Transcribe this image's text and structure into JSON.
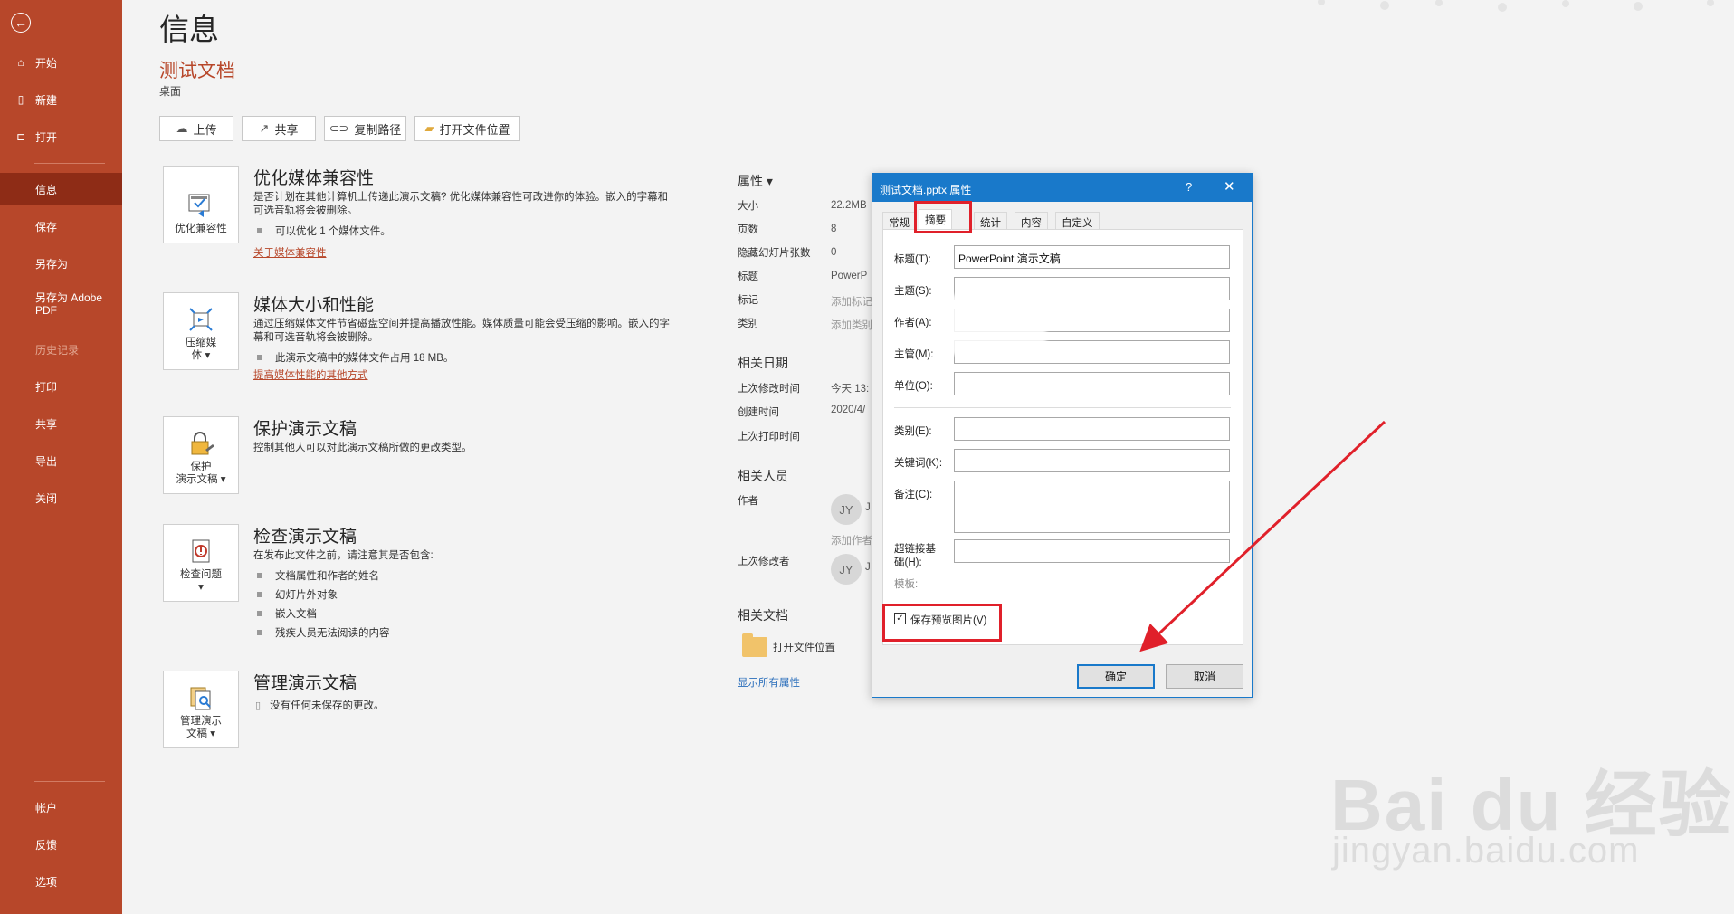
{
  "sidebar": {
    "items": [
      {
        "label": "开始",
        "icon": "home-icon"
      },
      {
        "label": "新建",
        "icon": "new-file-icon"
      },
      {
        "label": "打开",
        "icon": "open-folder-icon"
      },
      {
        "label": "信息"
      },
      {
        "label": "保存"
      },
      {
        "label": "另存为"
      },
      {
        "label": "另存为 Adobe PDF"
      },
      {
        "label": "历史记录"
      },
      {
        "label": "打印"
      },
      {
        "label": "共享"
      },
      {
        "label": "导出"
      },
      {
        "label": "关闭"
      }
    ],
    "bottom_items": [
      {
        "label": "帐户"
      },
      {
        "label": "反馈"
      },
      {
        "label": "选项"
      }
    ]
  },
  "main": {
    "page_title": "信息",
    "doc_title": "测试文档",
    "doc_location": "桌面",
    "toolbar": {
      "upload": "上传",
      "share": "共享",
      "copy_path": "复制路径",
      "open_location": "打开文件位置"
    },
    "sections": {
      "optimize": {
        "icon_label": "优化兼容性",
        "title": "优化媒体兼容性",
        "desc": "是否计划在其他计算机上传递此演示文稿? 优化媒体兼容性可改进你的体验。嵌入的字幕和可选音轨将会被删除。",
        "bullets": [
          "可以优化 1 个媒体文件。"
        ],
        "link": "关于媒体兼容性"
      },
      "compress": {
        "icon_label_1": "压缩媒",
        "icon_label_2": "体 ▾",
        "title": "媒体大小和性能",
        "desc": "通过压缩媒体文件节省磁盘空间并提高播放性能。媒体质量可能会受压缩的影响。嵌入的字幕和可选音轨将会被删除。",
        "bullets": [
          "此演示文稿中的媒体文件占用 18 MB。"
        ],
        "link": "提高媒体性能的其他方式"
      },
      "protect": {
        "icon_label_1": "保护",
        "icon_label_2": "演示文稿 ▾",
        "title": "保护演示文稿",
        "desc": "控制其他人可以对此演示文稿所做的更改类型。"
      },
      "inspect": {
        "icon_label_1": "检查问题",
        "icon_label_2": "▾",
        "title": "检查演示文稿",
        "desc": "在发布此文件之前，请注意其是否包含:",
        "bullets": [
          "文档属性和作者的姓名",
          "幻灯片外对象",
          "嵌入文档",
          "残疾人员无法阅读的内容"
        ]
      },
      "manage": {
        "icon_label_1": "管理演示",
        "icon_label_2": "文稿 ▾",
        "title": "管理演示文稿",
        "desc": "没有任何未保存的更改。"
      }
    },
    "properties": {
      "heading": "属性 ▾",
      "rows": [
        {
          "label": "大小",
          "value": "22.2MB"
        },
        {
          "label": "页数",
          "value": "8"
        },
        {
          "label": "隐藏幻灯片张数",
          "value": "0"
        },
        {
          "label": "标题",
          "value": "PowerP"
        },
        {
          "label": "标记",
          "value": "添加标记"
        },
        {
          "label": "类别",
          "value": "添加类别"
        }
      ],
      "dates_heading": "相关日期",
      "dates": [
        {
          "label": "上次修改时间",
          "value": "今天 13:"
        },
        {
          "label": "创建时间",
          "value": "2020/4/"
        },
        {
          "label": "上次打印时间",
          "value": ""
        }
      ],
      "people_heading": "相关人员",
      "author_label": "作者",
      "author_initials": "JY",
      "author_name": "J",
      "add_author": "添加作者",
      "last_modified_by_label": "上次修改者",
      "modifier_initials": "JY",
      "modifier_name": "J",
      "docs_heading": "相关文档",
      "open_location": "打开文件位置",
      "show_all": "显示所有属性"
    }
  },
  "dialog": {
    "title": "测试文档.pptx 属性",
    "help": "?",
    "close": "✕",
    "tabs": [
      "常规",
      "摘要",
      "统计",
      "内容",
      "自定义"
    ],
    "fields": {
      "title_label": "标题(T):",
      "title_value": "PowerPoint 演示文稿",
      "subject_label": "主题(S):",
      "author_label": "作者(A):",
      "manager_label": "主管(M):",
      "company_label": "单位(O):",
      "category_label": "类别(E):",
      "keywords_label": "关键词(K):",
      "comments_label": "备注(C):",
      "hyperlink_label_1": "超链接基",
      "hyperlink_label_2": "础(H):",
      "template_label": "模板:"
    },
    "checkbox_label": "保存预览图片(V)",
    "checkbox_checked": true,
    "ok": "确定",
    "cancel": "取消"
  },
  "watermark": {
    "brand": "Bai du 经验",
    "url": "jingyan.baidu.com"
  },
  "colors": {
    "accent": "#b7472a",
    "sidebar_active": "#8e2c16",
    "dialog_title": "#1979ca",
    "annotation": "#e0202a"
  }
}
